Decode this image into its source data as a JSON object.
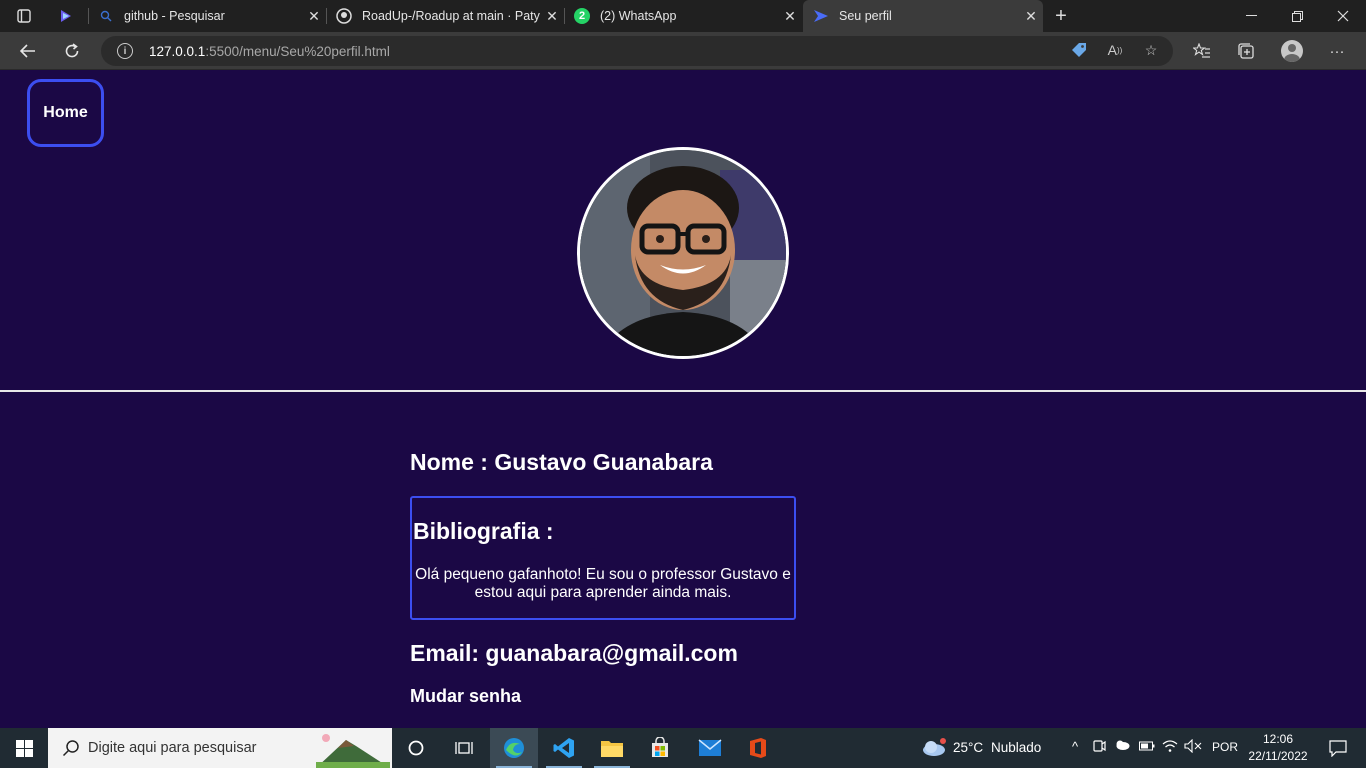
{
  "browser": {
    "tabs": [
      {
        "title": "github - Pesquisar"
      },
      {
        "title": "RoadUp-/Roadup at main · Patyh"
      },
      {
        "title": "(2) WhatsApp",
        "badge": "2"
      },
      {
        "title": "Seu perfil"
      }
    ],
    "address": {
      "host": "127.0.0.1",
      "path": ":5500/menu/Seu%20perfil.html"
    }
  },
  "page": {
    "home_label": "Home",
    "name_text": "Nome : Gustavo Guanabara",
    "bio_title": "Bibliografia :",
    "bio_text": "Olá pequeno gafanhoto! Eu sou o professor Gustavo e estou aqui para aprender ainda mais.",
    "email_text": "Email: guanabara@gmail.com",
    "change_password": "Mudar senha",
    "accent_color": "#3c4ef0",
    "background_color": "#1b0845"
  },
  "taskbar": {
    "search_placeholder": "Digite aqui para pesquisar",
    "weather_temp": "25°C",
    "weather_desc": "Nublado",
    "language": "POR",
    "time": "12:06",
    "date": "22/11/2022"
  }
}
